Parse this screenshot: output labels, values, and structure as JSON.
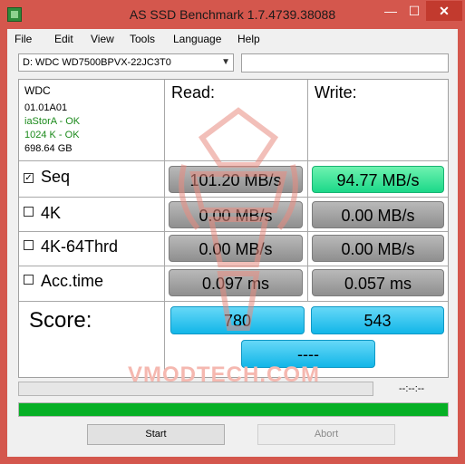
{
  "window": {
    "title": "AS SSD Benchmark 1.7.4739.38088",
    "controls": {
      "minimize": "—",
      "maximize": "☐",
      "close": "✕"
    }
  },
  "menu": [
    "File",
    "Edit",
    "View",
    "Tools",
    "Language",
    "Help"
  ],
  "drive": {
    "selected": "D: WDC WD7500BPVX-22JC3T0",
    "search_value": ""
  },
  "info": {
    "model": "WDC",
    "firmware": "01.01A01",
    "driver": "iaStorA - OK",
    "alignment": "1024 K - OK",
    "size": "698.64 GB"
  },
  "columns": {
    "read": "Read:",
    "write": "Write:"
  },
  "rows": [
    {
      "label": "Seq",
      "checked": true,
      "read": "101.20 MB/s",
      "write": "94.77 MB/s"
    },
    {
      "label": "4K",
      "checked": false,
      "read": "0.00 MB/s",
      "write": "0.00 MB/s"
    },
    {
      "label": "4K-64Thrd",
      "checked": false,
      "read": "0.00 MB/s",
      "write": "0.00 MB/s"
    },
    {
      "label": "Acc.time",
      "checked": false,
      "read": "0.097 ms",
      "write": "0.057 ms"
    }
  ],
  "score": {
    "label": "Score:",
    "read": "780",
    "write": "543",
    "total": "----"
  },
  "watermark": "VMODTECH.COM",
  "status": {
    "elapsed": "--:--:--",
    "progress_fraction": 0.0,
    "overall_fraction": 1.0
  },
  "buttons": {
    "start": "Start",
    "abort": "Abort"
  },
  "colors": {
    "window_frame": "#d4574d",
    "progress_green": "#06b025",
    "result_blue": "#12b6e8",
    "result_green": "#1cd889",
    "result_gray": "#8f8f8f"
  }
}
